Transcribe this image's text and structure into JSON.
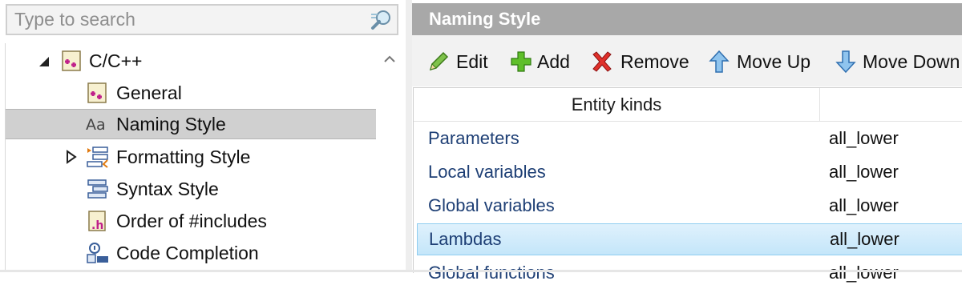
{
  "search": {
    "placeholder": "Type to search"
  },
  "tree": {
    "items": [
      {
        "label": "C/C++",
        "icon": "cpp-category-icon",
        "expanded": true
      },
      {
        "label": "General",
        "icon": "cpp-general-icon"
      },
      {
        "label": "Naming Style",
        "icon": "naming-style-icon",
        "selected": true
      },
      {
        "label": "Formatting Style",
        "icon": "formatting-style-icon",
        "expandable": true
      },
      {
        "label": "Syntax Style",
        "icon": "syntax-style-icon"
      },
      {
        "label": "Order of #includes",
        "icon": "include-order-icon"
      },
      {
        "label": "Code Completion",
        "icon": "code-completion-icon"
      }
    ]
  },
  "header": {
    "title": "Naming Style"
  },
  "toolbar": {
    "edit_label": "Edit",
    "add_label": "Add",
    "remove_label": "Remove",
    "move_up_label": "Move Up",
    "move_down_label": "Move Down"
  },
  "table": {
    "columns": [
      "Entity kinds",
      ""
    ],
    "rows": [
      {
        "entity": "Parameters",
        "style": "all_lower"
      },
      {
        "entity": "Local variables",
        "style": "all_lower"
      },
      {
        "entity": "Global variables",
        "style": "all_lower"
      },
      {
        "entity": "Lambdas",
        "style": "all_lower",
        "selected": true
      },
      {
        "entity": "Global functions",
        "style": "all_lower"
      }
    ]
  },
  "colors": {
    "header_bg": "#a8a8a8",
    "selection_tree": "#d0d0d0",
    "selection_table": "#c4e6fa",
    "link_text": "#1e3f75"
  }
}
